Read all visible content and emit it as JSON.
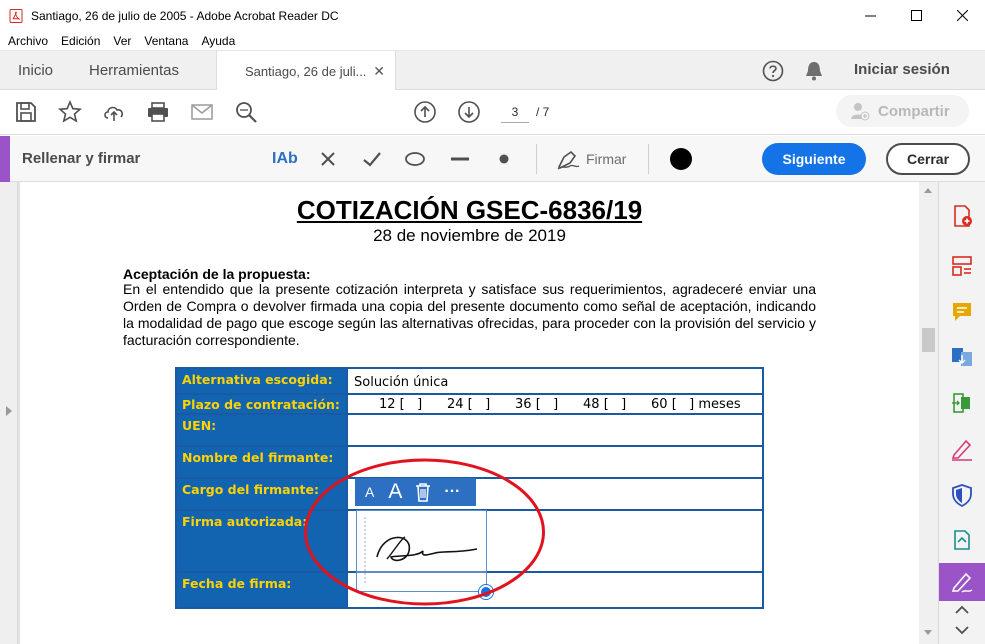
{
  "window": {
    "title": "Santiago, 26 de julio de 2005 - Adobe Acrobat Reader DC"
  },
  "menu": [
    "Archivo",
    "Edición",
    "Ver",
    "Ventana",
    "Ayuda"
  ],
  "tabs": {
    "home": "Inicio",
    "tools": "Herramientas",
    "document": "Santiago, 26 de juli..."
  },
  "header": {
    "signin": "Iniciar sesión"
  },
  "toolbar": {
    "page_current": "3",
    "page_total": "/ 7",
    "share": "Compartir"
  },
  "fill_sign": {
    "title": "Rellenar y firmar",
    "text_tool": "IAb",
    "sign": "Firmar",
    "next": "Siguiente",
    "close": "Cerrar",
    "color": "#000000"
  },
  "document": {
    "title": "COTIZACIÓN GSEC-6836/19",
    "date": "28 de noviembre de 2019",
    "heading": "Aceptación de la propuesta:",
    "body": "En el entendido que la presente cotización interpreta y satisface sus requerimientos, agradeceré enviar una Orden de Compra o devolver firmada una copia del presente documento como señal de aceptación, indicando la modalidad de pago que escoge según las alternativas ofrecidas, para proceder con la provisión del servicio y facturación correspondiente.",
    "form": [
      {
        "label": "Alternativa escogida:",
        "value": "Solución única"
      },
      {
        "label": "Plazo de contratación:",
        "value": "12 [   ]      24 [   ]      36 [   ]      48 [   ]      60 [   ] meses"
      },
      {
        "label": "UEN:",
        "value": ""
      },
      {
        "label": "Nombre del firmante:",
        "value": ""
      },
      {
        "label": "Cargo del firmante:",
        "value": ""
      },
      {
        "label": "Firma autorizada:",
        "value": ""
      },
      {
        "label": "Fecha de firma:",
        "value": ""
      }
    ]
  },
  "signature_toolbar": {
    "small_a": "A",
    "large_a": "A",
    "more": "···"
  },
  "colors": {
    "accent_purple": "#9a54c7",
    "primary_blue": "#1473e6",
    "form_label_bg": "#1264b0",
    "form_label_text": "#ffd200",
    "annotation_red": "#e0141e"
  }
}
